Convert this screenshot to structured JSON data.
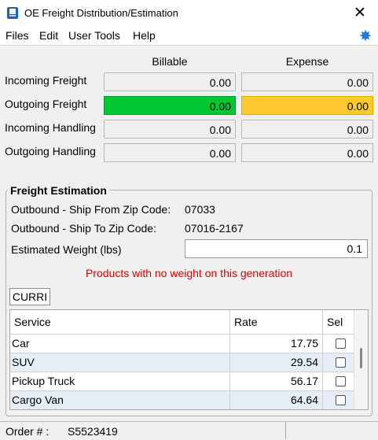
{
  "window": {
    "title": "OE Freight Distribution/Estimation",
    "close_glyph": "✕"
  },
  "menu": {
    "files": "Files",
    "edit": "Edit",
    "user_tools": "User Tools",
    "help": "Help"
  },
  "columns": {
    "billable": "Billable",
    "expense": "Expense"
  },
  "rows": [
    {
      "label": "Incoming Freight",
      "billable": "0.00",
      "expense": "0.00"
    },
    {
      "label": "Outgoing Freight",
      "billable": "0.00",
      "expense": "0.00"
    },
    {
      "label": "Incoming Handling",
      "billable": "0.00",
      "expense": "0.00"
    },
    {
      "label": "Outgoing Handling",
      "billable": "0.00",
      "expense": "0.00"
    }
  ],
  "estimation": {
    "title": "Freight Estimation",
    "ship_from_label": "Outbound - Ship From Zip Code:",
    "ship_from_value": "07033",
    "ship_to_label": "Outbound - Ship To Zip Code:",
    "ship_to_value": "07016-2167",
    "weight_label": "Estimated Weight (lbs)",
    "weight_value": "0.1",
    "warning": "Products with no weight on this generation",
    "tab": "CURRI",
    "grid_headers": {
      "service": "Service",
      "rate": "Rate",
      "sel": "Sel"
    },
    "services": [
      {
        "service": "Car",
        "rate": "17.75",
        "selected": false
      },
      {
        "service": "SUV",
        "rate": "29.54",
        "selected": false
      },
      {
        "service": "Pickup Truck",
        "rate": "56.17",
        "selected": false
      },
      {
        "service": "Cargo Van",
        "rate": "64.64",
        "selected": false
      }
    ]
  },
  "status": {
    "order_label": "Order # :",
    "order_value": "S5523419"
  },
  "colors": {
    "highlight_green": "#00c832",
    "highlight_yellow": "#ffca30",
    "warning_red": "#e00000",
    "help_blue": "#1f7be2"
  }
}
